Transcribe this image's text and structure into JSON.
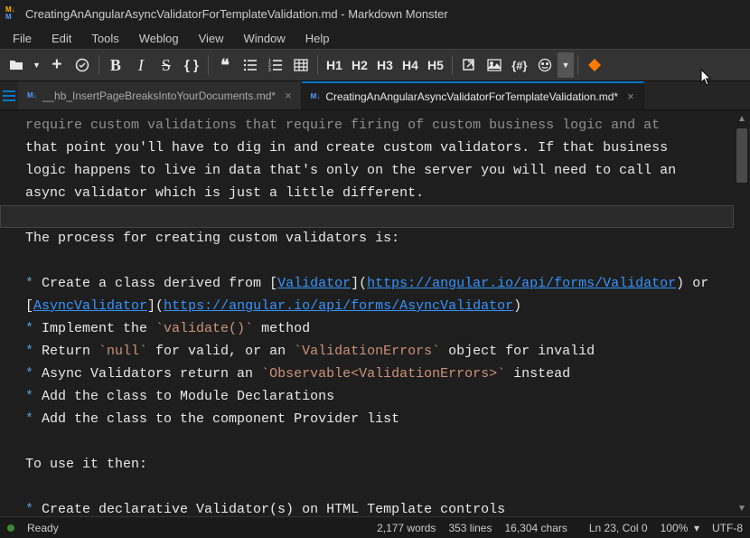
{
  "title": "CreatingAnAngularAsyncValidatorForTemplateValidation.md  - Markdown Monster",
  "menu": [
    "File",
    "Edit",
    "Tools",
    "Weblog",
    "View",
    "Window",
    "Help"
  ],
  "toolbar": {
    "headers": [
      "H1",
      "H2",
      "H3",
      "H4",
      "H5"
    ],
    "braces": "{ }",
    "hash_braces": "{#}"
  },
  "tabs": [
    {
      "label": "__hb_InsertPageBreaksIntoYourDocuments.md*",
      "active": false
    },
    {
      "label": "CreatingAnAngularAsyncValidatorForTemplateValidation.md*",
      "active": true
    }
  ],
  "editor": {
    "line_top_dim": "require custom validations that require firing of custom business logic and at",
    "line1": "that point you'll have to dig in and create custom validators. If that business",
    "line2": "logic happens to live in data that's only on the server you will need to call an",
    "line3": "async validator which is just a little different.",
    "blank": "",
    "line4": "The process for creating custom validators is:",
    "b1_pre": "* Create a class derived from ",
    "b1_link1_text": "Validator",
    "b1_link1_url": "https://angular.io/api/forms/Validator",
    "b1_mid": " or ",
    "b1_link2_text": "AsyncValidator",
    "b1_link2_url": "https://angular.io/api/forms/AsyncValidator",
    "b2": "* Implement the `validate()` method",
    "b3": "* Return `null` for valid, or an `ValidationErrors` object for invalid",
    "b4": "* Async Validators return an `Observable<ValidationErrors>` instead",
    "b5": "* Add the class to Module Declarations",
    "b6": "* Add the class to the component Provider list",
    "line5": "To use it then:",
    "b7": "* Create declarative Validator(s) on HTML Template controls"
  },
  "status": {
    "ready": "Ready",
    "words": "2,177 words",
    "lines": "353 lines",
    "chars": "16,304 chars",
    "pos": "Ln 23, Col 0",
    "zoom": "100%",
    "encoding": "UTF-8"
  }
}
